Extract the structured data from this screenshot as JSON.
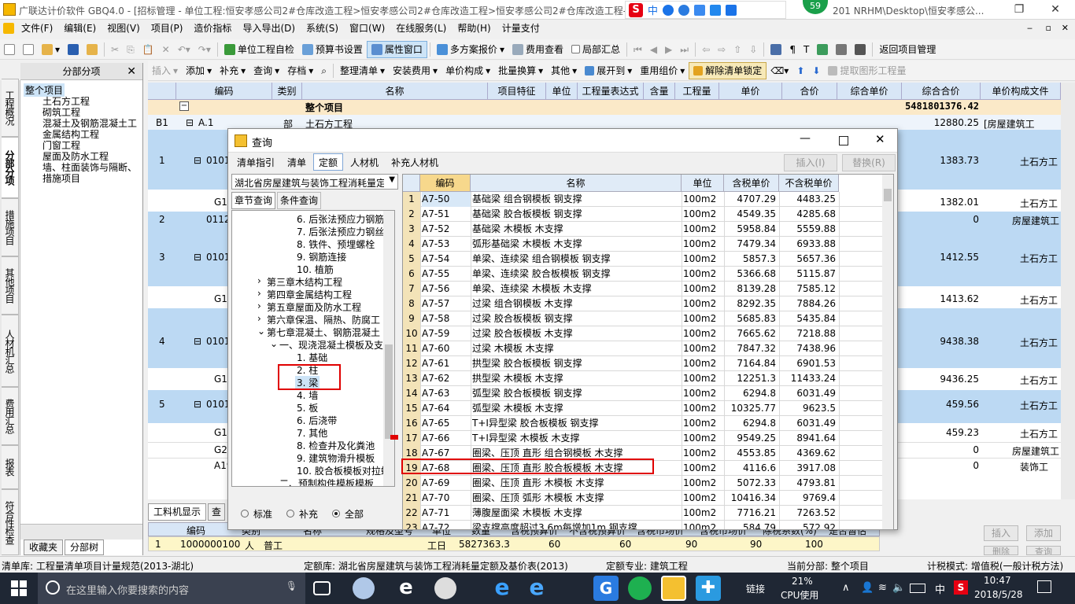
{
  "window": {
    "title": "广联达计价软件 GBQ4.0 - [招标管理 - 单位工程:恒安孝感公司2#仓库改造工程>恒安孝感公司2#仓库改造工程>恒安孝感公司2#仓库改造工程-土",
    "title_right": "201 NRHM\\Desktop\\恒安孝感公...",
    "badge": "59"
  },
  "menu": [
    "文件(F)",
    "编辑(E)",
    "视图(V)",
    "项目(P)",
    "造价指标",
    "导入导出(D)",
    "系统(S)",
    "窗口(W)",
    "在线服务(L)",
    "帮助(H)",
    "计量支付"
  ],
  "toolbar1": {
    "check": "单位工程自检",
    "budget": "预算书设置",
    "attr": "属性窗口",
    "scheme": "多方案报价",
    "fee": "费用查看",
    "partial": "局部汇总",
    "back": "返回项目管理"
  },
  "toolbar2": [
    "插入",
    "添加",
    "补充",
    "查询",
    "存档",
    "整理清单",
    "安装费用",
    "单价构成",
    "批量换算",
    "其他",
    "展开到",
    "重用组价",
    "解除清单锁定",
    "提取图形工程量"
  ],
  "left_tabs": [
    "工程概况",
    "分部分项",
    "措施项目",
    "其他项目",
    "人材机汇总",
    "费用汇总",
    "报表",
    "符合性检查"
  ],
  "tree": {
    "header": "分部分项",
    "items": [
      "整个项目",
      "土石方工程",
      "砌筑工程",
      "混凝土及钢筋混凝土工",
      "金属结构工程",
      "门窗工程",
      "屋面及防水工程",
      "墙、柱面装饰与隔断、",
      "措施项目"
    ],
    "bottom_tabs": [
      "收藏夹",
      "分部树"
    ]
  },
  "grid": {
    "headers": [
      "编码",
      "类别",
      "名称",
      "项目特征",
      "单位",
      "工程量表达式",
      "含量",
      "工程量",
      "单价",
      "合价",
      "综合单价",
      "综合合价",
      "单价构成文件"
    ],
    "total_row": {
      "label": "整个项目",
      "total": "5481801376.42"
    },
    "rows": [
      {
        "num": "B1",
        "code": "A.1",
        "type": "部",
        "name": "土石方工程",
        "total": "12880.25",
        "file": "[房屋建筑工"
      },
      {
        "num": "1",
        "code": "01010",
        "total": "1383.73",
        "file": "土石方工"
      },
      {
        "num": "",
        "code": "G1-",
        "total": "1382.01",
        "file": "土石方工"
      },
      {
        "num": "2",
        "code": "01120",
        "total": "0",
        "file": "房屋建筑工"
      },
      {
        "num": "3",
        "code": "01010",
        "total": "1412.55",
        "file": "土石方工"
      },
      {
        "num": "",
        "code": "G1-",
        "total": "1413.62",
        "file": "土石方工"
      },
      {
        "num": "4",
        "code": "01010",
        "total": "9438.38",
        "file": "土石方工"
      },
      {
        "num": "",
        "code": "G1-",
        "total": "9436.25",
        "file": "土石方工"
      },
      {
        "num": "5",
        "code": "01010",
        "total": "459.56",
        "file": "土石方工"
      },
      {
        "num": "",
        "code": "G1-",
        "total": "459.23",
        "file": "土石方工"
      },
      {
        "num": "",
        "code": "G2-",
        "total": "0",
        "file": "房屋建筑工"
      },
      {
        "num": "",
        "code": "A19",
        "total": "0",
        "file": "装饰工"
      }
    ]
  },
  "bottom": {
    "tabs": [
      "工料机显示",
      "查"
    ],
    "headers": [
      "编码",
      "类别",
      "名称",
      "规格及型号",
      "单位",
      "数量",
      "含税预算价",
      "不含税预算价",
      "含税市场价",
      "含税市场价",
      "除税系数(%)",
      "是否暂估"
    ],
    "row": {
      "num": "1",
      "code": "1000000100",
      "type": "人",
      "name": "普工",
      "unit": "工日",
      "qty": "5827363.3",
      "v1": "60",
      "v2": "60",
      "v3": "90",
      "v4": "90",
      "v5": "100"
    },
    "buttons": [
      "插入",
      "添加",
      "删除",
      "查询"
    ]
  },
  "dialog": {
    "title": "查询",
    "tabs": [
      "清单指引",
      "清单",
      "定额",
      "人材机",
      "补充人材机"
    ],
    "insert": "插入(I)",
    "replace": "替换(R)",
    "library": "湖北省房屋建筑与装饰工程消耗量定",
    "subtabs": [
      "章节查询",
      "条件查询"
    ],
    "tree": [
      "6. 后张法预应力钢筋",
      "7. 后张法预应力钢丝",
      "8. 铁件、预埋螺栓",
      "9. 钢筋连接",
      "10. 植筋",
      "第三章木结构工程",
      "第四章金属结构工程",
      "第五章屋面及防水工程",
      "第六章保温、隔热、防腐工",
      "第七章混凝土、钢筋混凝土",
      "一、现浇混凝土模板及支",
      "1. 基础",
      "2. 柱",
      "3. 梁",
      "4. 墙",
      "5. 板",
      "6. 后浇带",
      "7. 其他",
      "8. 检查井及化粪池",
      "9. 建筑物滑升模板",
      "10. 胶合板模板对拉螺",
      "二、预制构件模板模板"
    ],
    "radios": [
      "标准",
      "补充",
      "全部"
    ],
    "table_headers": [
      "编码",
      "名称",
      "单位",
      "含税单价",
      "不含税单价"
    ],
    "rows": [
      [
        "1",
        "A7-50",
        "基础梁 组合钢模板 钢支撑",
        "100m2",
        "4707.29",
        "4483.25"
      ],
      [
        "2",
        "A7-51",
        "基础梁 胶合板模板 钢支撑",
        "100m2",
        "4549.35",
        "4285.68"
      ],
      [
        "3",
        "A7-52",
        "基础梁 木模板 木支撑",
        "100m2",
        "5958.84",
        "5559.88"
      ],
      [
        "4",
        "A7-53",
        "弧形基础梁 木模板 木支撑",
        "100m2",
        "7479.34",
        "6933.88"
      ],
      [
        "5",
        "A7-54",
        "单梁、连续梁 组合钢模板 钢支撑",
        "100m2",
        "5857.3",
        "5657.36"
      ],
      [
        "6",
        "A7-55",
        "单梁、连续梁 胶合板模板 钢支撑",
        "100m2",
        "5366.68",
        "5115.87"
      ],
      [
        "7",
        "A7-56",
        "单梁、连续梁 木模板 木支撑",
        "100m2",
        "8139.28",
        "7585.12"
      ],
      [
        "8",
        "A7-57",
        "过梁 组合钢模板 木支撑",
        "100m2",
        "8292.35",
        "7884.26"
      ],
      [
        "9",
        "A7-58",
        "过梁 胶合板模板 钢支撑",
        "100m2",
        "5685.83",
        "5435.84"
      ],
      [
        "10",
        "A7-59",
        "过梁 胶合板模板 木支撑",
        "100m2",
        "7665.62",
        "7218.88"
      ],
      [
        "11",
        "A7-60",
        "过梁 木模板 木支撑",
        "100m2",
        "7847.32",
        "7438.96"
      ],
      [
        "12",
        "A7-61",
        "拱型梁 胶合板模板 钢支撑",
        "100m2",
        "7164.84",
        "6901.53"
      ],
      [
        "13",
        "A7-62",
        "拱型梁 木模板 木支撑",
        "100m2",
        "12251.3",
        "11433.24"
      ],
      [
        "14",
        "A7-63",
        "弧型梁 胶合板模板 钢支撑",
        "100m2",
        "6294.8",
        "6031.49"
      ],
      [
        "15",
        "A7-64",
        "弧型梁 木模板 木支撑",
        "100m2",
        "10325.77",
        "9623.5"
      ],
      [
        "16",
        "A7-65",
        "T+I异型梁 胶合板模板 钢支撑",
        "100m2",
        "6294.8",
        "6031.49"
      ],
      [
        "17",
        "A7-66",
        "T+I异型梁 木模板 木支撑",
        "100m2",
        "9549.25",
        "8941.64"
      ],
      [
        "18",
        "A7-67",
        "圈梁、压顶 直形 组合钢模板 木支撑",
        "100m2",
        "4553.85",
        "4369.62"
      ],
      [
        "19",
        "A7-68",
        "圈梁、压顶 直形 胶合板模板 木支撑",
        "100m2",
        "4116.6",
        "3917.08"
      ],
      [
        "20",
        "A7-69",
        "圈梁、压顶 直形 木模板 木支撑",
        "100m2",
        "5072.33",
        "4793.81"
      ],
      [
        "21",
        "A7-70",
        "圈梁、压顶 弧形 木模板 木支撑",
        "100m2",
        "10416.34",
        "9769.4"
      ],
      [
        "22",
        "A7-71",
        "薄腹屋面梁 木模板 木支撑",
        "100m2",
        "7716.21",
        "7263.52"
      ],
      [
        "23",
        "A7-72",
        "梁支撑高度超过3.6m每增加1m 钢支撑",
        "100m2",
        "584.79",
        "572.92"
      ]
    ]
  },
  "status": {
    "list_lib": "清单库: 工程量清单项目计量规范(2013-湖北)",
    "quota_lib": "定额库: 湖北省房屋建筑与装饰工程消耗量定额及基价表(2013)",
    "spec": "定额专业: 建筑工程",
    "current": "当前分部: 整个项目",
    "tax": "计税模式: 增值税(一般计税方法)"
  },
  "taskbar": {
    "search": "在这里输入你要搜索的内容",
    "link": "链接",
    "cpu_pct": "21%",
    "cpu_label": "CPU使用",
    "lang": "中",
    "time": "10:47",
    "date": "2018/5/28"
  },
  "colors": {
    "accent": "#cde4f7",
    "selected_row": "#bcd9f3",
    "highlight_box": "#e00000"
  }
}
